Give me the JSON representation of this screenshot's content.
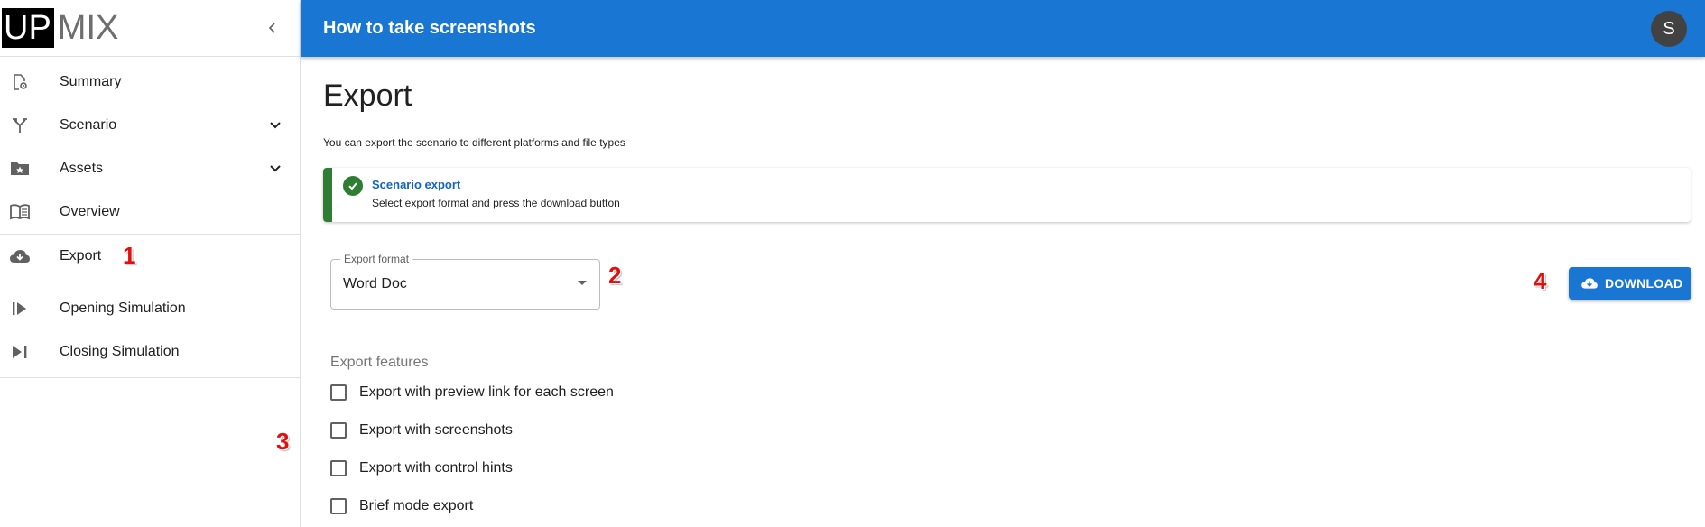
{
  "logo": {
    "part1": "UP",
    "part2": "MIX"
  },
  "header": {
    "title": "How to take screenshots",
    "avatar_initial": "S"
  },
  "sidebar": {
    "items": [
      {
        "label": "Summary",
        "icon": "file-settings-icon",
        "expandable": false
      },
      {
        "label": "Scenario",
        "icon": "scenario-split-icon",
        "expandable": true
      },
      {
        "label": "Assets",
        "icon": "folder-star-icon",
        "expandable": true
      },
      {
        "label": "Overview",
        "icon": "book-open-icon",
        "expandable": false
      },
      {
        "label": "Export",
        "icon": "cloud-download-icon",
        "expandable": false
      },
      {
        "label": "Opening Simulation",
        "icon": "play-start-icon",
        "expandable": false
      },
      {
        "label": "Closing Simulation",
        "icon": "skip-end-icon",
        "expandable": false
      }
    ]
  },
  "annotations": {
    "m1": "1",
    "m2": "2",
    "m3": "3",
    "m4": "4"
  },
  "main": {
    "title": "Export",
    "subtitle": "You can export the scenario to different platforms and file types",
    "alert": {
      "title": "Scenario export",
      "text": "Select export format and press the download button",
      "color": "#2e7d32"
    },
    "export_format": {
      "label": "Export format",
      "value": "Word Doc"
    },
    "download_label": "DOWNLOAD",
    "features_title": "Export features",
    "features": [
      {
        "label": "Export with preview link for each screen",
        "checked": false
      },
      {
        "label": "Export with screenshots",
        "checked": false
      },
      {
        "label": "Export with control hints",
        "checked": false
      },
      {
        "label": "Brief mode export",
        "checked": false
      }
    ]
  },
  "colors": {
    "primary": "#1976d2",
    "success": "#2e7d32",
    "marker": "#e01010"
  }
}
